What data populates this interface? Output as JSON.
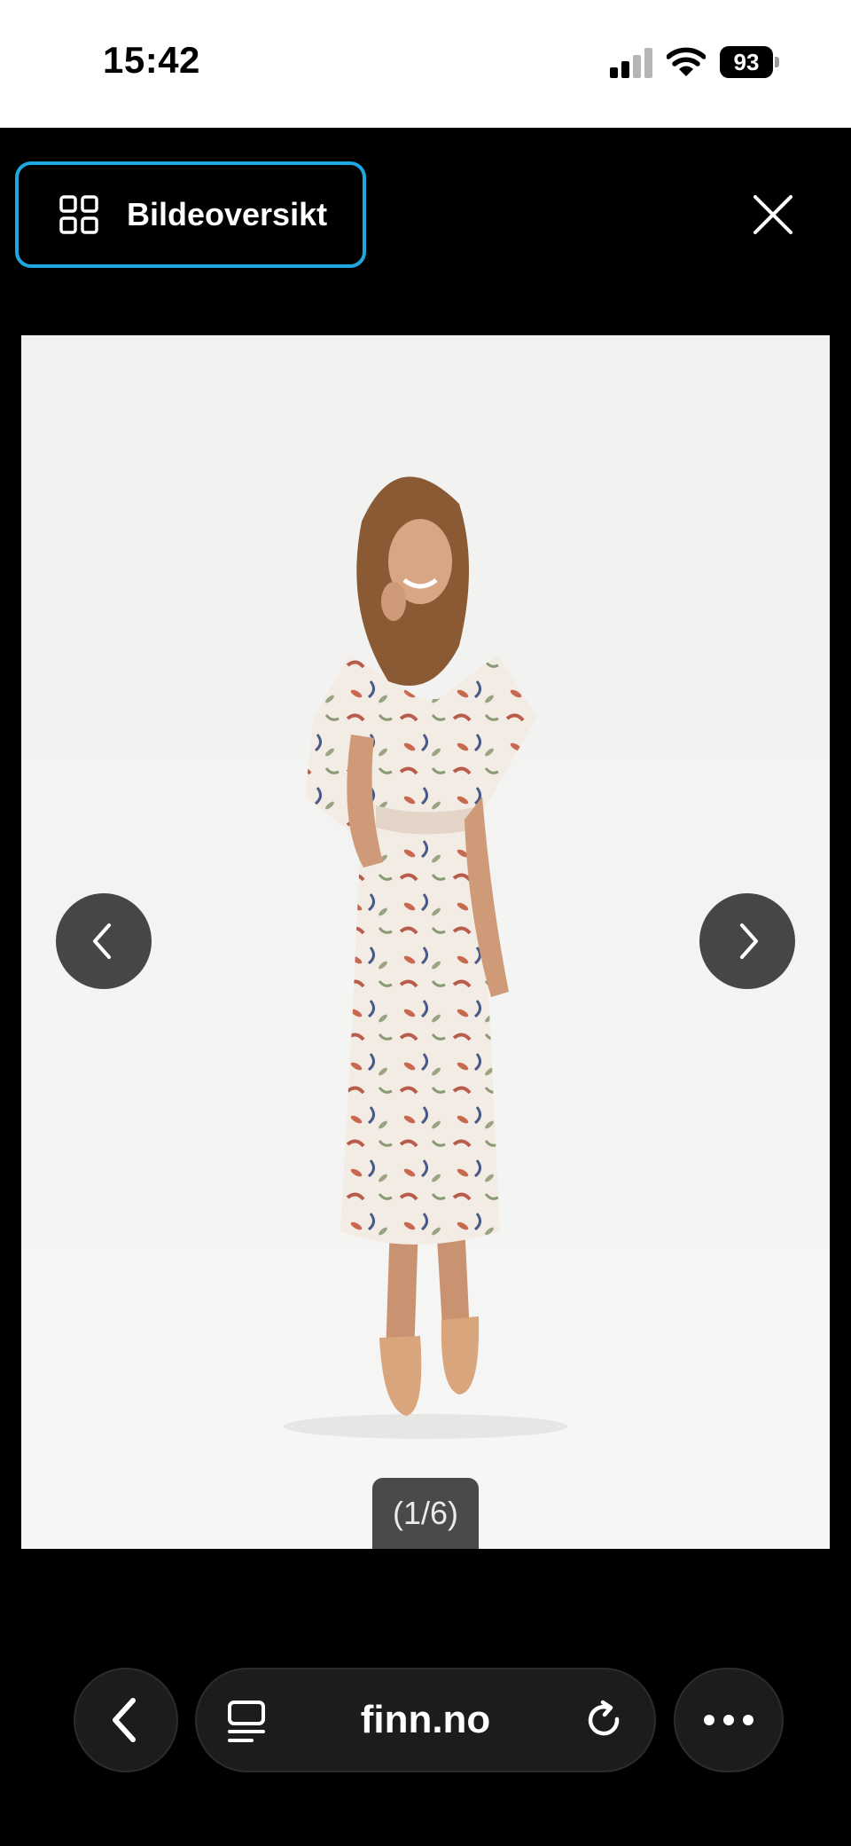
{
  "status": {
    "time": "15:42",
    "battery": "93",
    "icons": [
      "signal-icon",
      "wifi-icon",
      "battery-icon"
    ]
  },
  "viewer": {
    "overview_label": "Bildeoversikt",
    "overview_icon": "grid-icon",
    "close_icon": "close-icon",
    "prev_icon": "chevron-left-icon",
    "next_icon": "chevron-right-icon",
    "counter": "(1/6)",
    "accent_color": "#1ea7e0"
  },
  "browser": {
    "url": "finn.no",
    "icons": [
      "back-icon",
      "tabs-icon",
      "reload-icon",
      "more-icon"
    ]
  }
}
